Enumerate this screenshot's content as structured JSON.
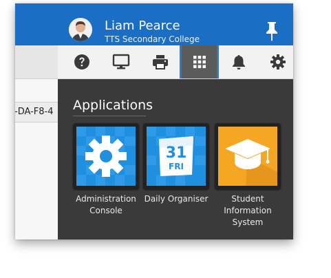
{
  "background": {
    "partial_cell_text": "-DA-F8-4"
  },
  "header": {
    "user_name": "Liam Pearce",
    "school": "TTS Secondary College",
    "pin_icon": "pin-icon"
  },
  "toolbar": {
    "items": [
      {
        "icon": "help-icon"
      },
      {
        "icon": "monitor-icon"
      },
      {
        "icon": "printer-icon"
      },
      {
        "icon": "apps-grid-icon",
        "active": true
      },
      {
        "icon": "bell-icon"
      },
      {
        "icon": "gear-icon"
      }
    ]
  },
  "applications": {
    "title": "Applications",
    "items": [
      {
        "label": "Administration Console",
        "icon": "gear-tile-icon"
      },
      {
        "label": "Daily Organiser",
        "icon": "calendar-tile-icon",
        "day": "31",
        "weekday": "FRI"
      },
      {
        "label": "Student Information System",
        "icon": "graduation-cap-tile-icon"
      }
    ]
  },
  "colors": {
    "header_blue": "#1a6fc4",
    "panel_dark": "#3a3a3a",
    "tile_blue": "#1f8fe0",
    "tile_orange": "#f5a623",
    "active_tool": "#5b5b5b"
  }
}
